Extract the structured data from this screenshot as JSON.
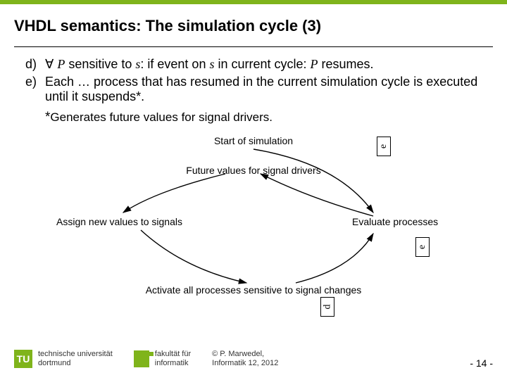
{
  "title": "VHDL semantics: The simulation cycle (3)",
  "items": {
    "d": {
      "label": "d)",
      "prefix": "∀ ",
      "p1": "P",
      "t1": " sensitive to ",
      "s1": "s",
      "t2": ": if event on ",
      "s2": "s",
      "t3": " in current cycle: ",
      "p2": "P",
      "t4": " resumes."
    },
    "e": {
      "label": "e)",
      "text": "Each … process that has resumed in the current simulation cycle is executed until it suspends*."
    }
  },
  "note_ast": "*",
  "note": "Generates future values for signal drivers.",
  "diagram": {
    "start": "Start of simulation",
    "future": "Future values for signal drivers",
    "assign": "Assign new values to signals",
    "evaluate": "Evaluate processes",
    "activate": "Activate all processes sensitive to signal changes"
  },
  "callouts": {
    "e1": "e",
    "e2": "e",
    "d": "d"
  },
  "footer": {
    "tu": "TU",
    "uni1": "technische universität",
    "uni2": "dortmund",
    "fac1": "fakultät für",
    "fac2": "informatik",
    "cop1": "© P. Marwedel,",
    "cop2": "Informatik 12,  2012"
  },
  "page": "-  14 -"
}
